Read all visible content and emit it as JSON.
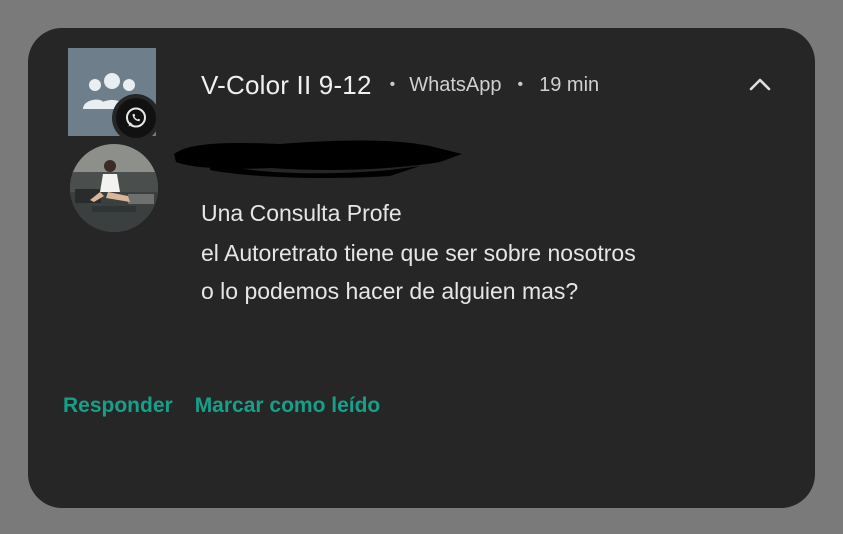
{
  "notification": {
    "title": "V-Color II 9-12",
    "app_name": "WhatsApp",
    "time": "19 min",
    "message_lines": [
      "Una Consulta Profe",
      "el Autoretrato tiene que ser sobre nosotros",
      "o lo podemos hacer de alguien mas?"
    ],
    "actions": [
      "Responder",
      "Marcar como leído"
    ]
  },
  "icons": {
    "group_avatar": "group-icon",
    "app_badge": "whatsapp-icon",
    "collapse": "chevron-up-icon",
    "sender_avatar": "avatar"
  },
  "colors": {
    "background": "#7a7a7a",
    "card": "#262626",
    "accent": "#16a08a",
    "text": "#e6e6e6"
  }
}
